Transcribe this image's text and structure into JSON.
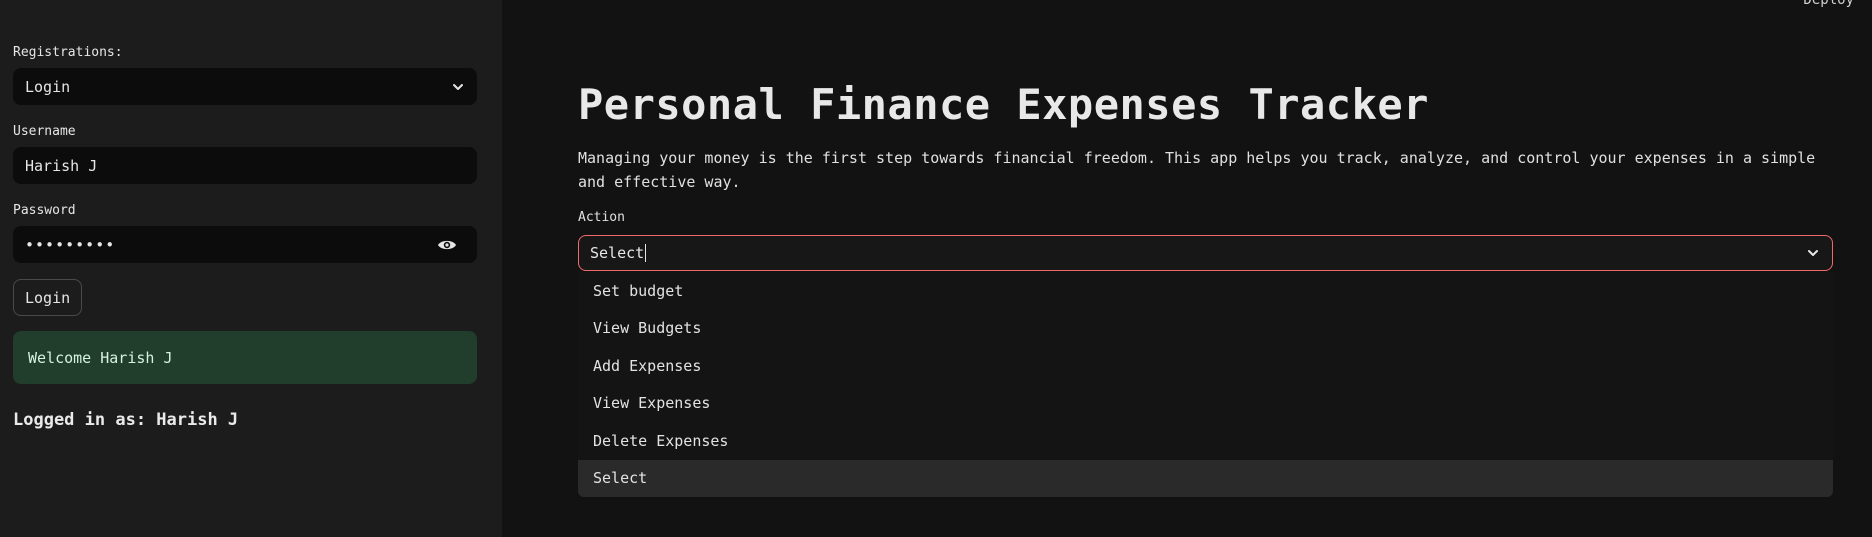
{
  "sidebar": {
    "registrations": {
      "label": "Registrations:",
      "value": "Login",
      "icon": "chevron-down-icon"
    },
    "username": {
      "label": "Username",
      "value": "Harish J"
    },
    "password": {
      "label": "Password",
      "value": "•••••••••",
      "icon": "eye-icon"
    },
    "login_button": "Login",
    "welcome_message": "Welcome Harish J",
    "logged_in_text": "Logged in as: Harish J"
  },
  "header": {
    "deploy_label": "Deploy"
  },
  "main": {
    "title": "Personal Finance Expenses Tracker",
    "description": "Managing your money is the first step towards financial freedom. This app helps you track, analyze, and control your expenses in a simple and effective way.",
    "action": {
      "label": "Action",
      "value": "Select",
      "options": [
        "Set budget",
        "View Budgets",
        "Add Expenses",
        "View Expenses",
        "Delete Expenses",
        "Select"
      ],
      "highlighted_option": "Select"
    }
  },
  "colors": {
    "sidebar_bg": "#1c1c1c",
    "main_bg": "#121212",
    "input_bg": "#0c0c0c",
    "success_bg": "#213d2c",
    "focus_border": "#ef6a6a",
    "highlight_bg": "#2a2a2a"
  }
}
